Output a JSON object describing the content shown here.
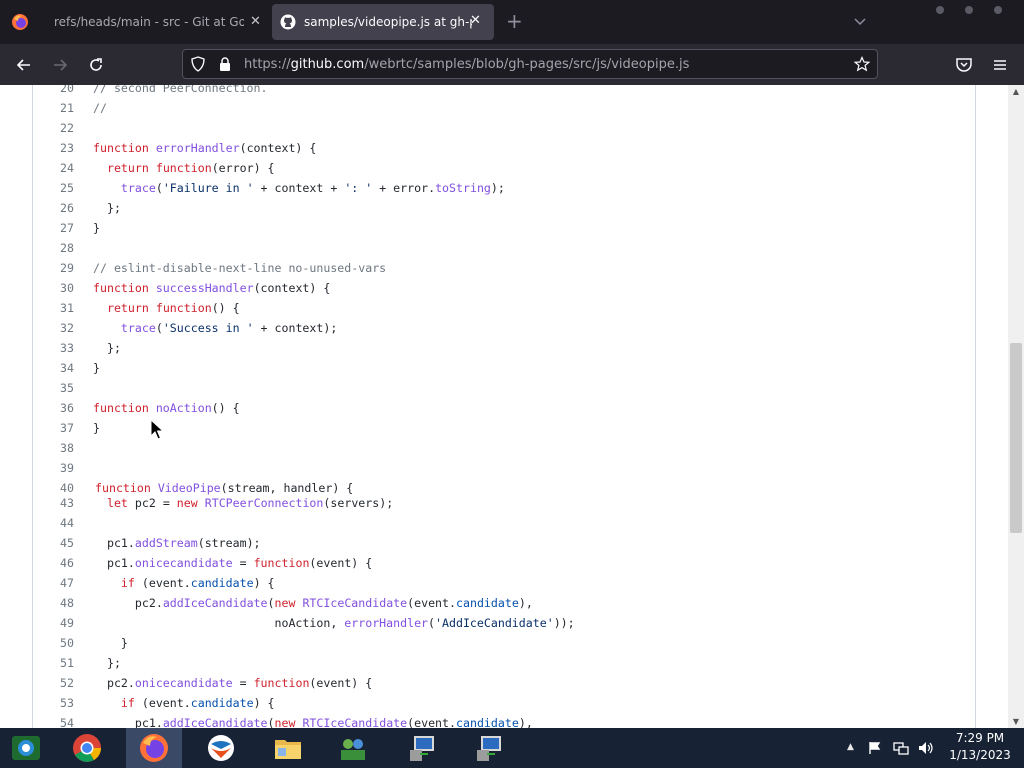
{
  "browser": {
    "tabs": [
      {
        "title": "refs/heads/main - src - Git at Google",
        "active": false
      },
      {
        "title": "samples/videopipe.js at gh-pages",
        "active": true
      }
    ],
    "tab_close": "✕",
    "new_tab": "+",
    "url": {
      "prefix": "https://",
      "domain": "github.com",
      "path": "/webrtc/samples/blob/gh-pages/src/js/videopipe.js"
    }
  },
  "code": {
    "lines": [
      {
        "n": "20",
        "html": "<span class=\"c\">// second PeerConnection.</span>"
      },
      {
        "n": "21",
        "html": "<span class=\"c\">//</span>"
      },
      {
        "n": "22",
        "html": ""
      },
      {
        "n": "23",
        "html": "<span class=\"k\">function</span> <span class=\"f\">errorHandler</span>(context) {"
      },
      {
        "n": "24",
        "html": "  <span class=\"k\">return</span> <span class=\"k\">function</span>(error) {"
      },
      {
        "n": "25",
        "html": "    <span class=\"f\">trace</span>(<span class=\"s\">'Failure in '</span> + context + <span class=\"s\">': '</span> + error.<span class=\"f\">toString</span>);"
      },
      {
        "n": "26",
        "html": "  };"
      },
      {
        "n": "27",
        "html": "}"
      },
      {
        "n": "28",
        "html": ""
      },
      {
        "n": "29",
        "html": "<span class=\"c\">// eslint-disable-next-line no-unused-vars</span>"
      },
      {
        "n": "30",
        "html": "<span class=\"k\">function</span> <span class=\"f\">successHandler</span>(context) {"
      },
      {
        "n": "31",
        "html": "  <span class=\"k\">return</span> <span class=\"k\">function</span>() {"
      },
      {
        "n": "32",
        "html": "    <span class=\"f\">trace</span>(<span class=\"s\">'Success in '</span> + context);"
      },
      {
        "n": "33",
        "html": "  };"
      },
      {
        "n": "34",
        "html": "}"
      },
      {
        "n": "35",
        "html": ""
      },
      {
        "n": "36",
        "html": "<span class=\"k\">function</span> <span class=\"f\">noAction</span>() {"
      },
      {
        "n": "37",
        "html": "}"
      },
      {
        "n": "38",
        "html": ""
      },
      {
        "n": "39",
        "html": ""
      },
      {
        "n": "40",
        "html": "<span class=\"k\">function</span> <span class=\"f\">VideoPipe</span>(stream, handler) {"
      },
      {
        "n": "43",
        "html": "  <span class=\"k\">let</span> pc2 = <span class=\"k\">new</span> <span class=\"f\">RTCPeerConnection</span>(servers);"
      },
      {
        "n": "44",
        "html": ""
      },
      {
        "n": "45",
        "html": "  pc1.<span class=\"f\">addStream</span>(stream);"
      },
      {
        "n": "46",
        "html": "  pc1.<span class=\"f\">onicecandidate</span> = <span class=\"k\">function</span>(event) {"
      },
      {
        "n": "47",
        "html": "    <span class=\"k\">if</span> (event.<span class=\"p\">candidate</span>) {"
      },
      {
        "n": "48",
        "html": "      pc2.<span class=\"f\">addIceCandidate</span>(<span class=\"k\">new</span> <span class=\"f\">RTCIceCandidate</span>(event.<span class=\"p\">candidate</span>),"
      },
      {
        "n": "49",
        "html": "                          noAction, <span class=\"f\">errorHandler</span>(<span class=\"s\">'AddIceCandidate'</span>));"
      },
      {
        "n": "50",
        "html": "    }"
      },
      {
        "n": "51",
        "html": "  };"
      },
      {
        "n": "52",
        "html": "  pc2.<span class=\"f\">onicecandidate</span> = <span class=\"k\">function</span>(event) {"
      },
      {
        "n": "53",
        "html": "    <span class=\"k\">if</span> (event.<span class=\"p\">candidate</span>) {"
      },
      {
        "n": "54",
        "html": "      pc1.<span class=\"f\">addIceCandidate</span>(<span class=\"k\">new</span> <span class=\"f\">RTCIceCandidate</span>(event.<span class=\"p\">candidate</span>),"
      }
    ]
  },
  "taskbar": {
    "apps": [
      "windows-media-center-icon",
      "chrome-icon",
      "firefox-icon",
      "windows-live-icon",
      "file-explorer-icon",
      "network-users-icon",
      "remote-desktop-icon",
      "remote-desktop-icon"
    ],
    "tray_expand": "▲",
    "time": "7:29 PM",
    "date": "1/13/2023"
  },
  "colors": {
    "keyword": "#cf222e",
    "function": "#8250df",
    "string": "#0a3069",
    "comment": "#6e7781"
  }
}
